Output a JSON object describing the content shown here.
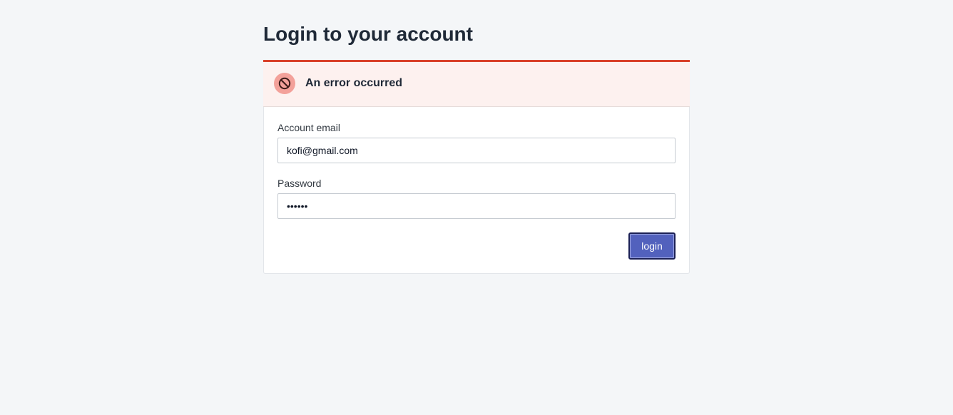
{
  "page": {
    "title": "Login to your account"
  },
  "alert": {
    "message": "An error occurred",
    "icon": "prohibited-icon",
    "color": "#d9402a"
  },
  "form": {
    "email": {
      "label": "Account email",
      "value": "kofi@gmail.com"
    },
    "password": {
      "label": "Password",
      "value": "••••••"
    },
    "submit_label": "login"
  },
  "colors": {
    "accent": "#5261bd",
    "error": "#d9402a",
    "background": "#f4f6f8"
  }
}
